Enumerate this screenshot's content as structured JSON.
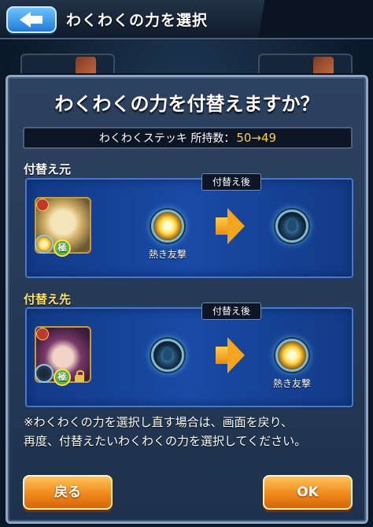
{
  "header": {
    "title": "わくわくの力を選択"
  },
  "dialog": {
    "title": "わくわくの力を付替えますか？",
    "item_name": "わくわくステッキ 所持数：",
    "item_count": "50→49",
    "source": {
      "label": "付替え元",
      "after_tag": "付替え後",
      "before_orb_caption": "熱き友撃",
      "after_orb_caption": ""
    },
    "target": {
      "label": "付替え先",
      "after_tag": "付替え後",
      "before_orb_caption": "",
      "after_orb_caption": "熱き友撃"
    },
    "notice_line1": "※わくわくの力を選択し直す場合は、画面を戻り、",
    "notice_line2": "再度、付替えたいわくわくの力を選択してください。",
    "buttons": {
      "back_label": "戻る",
      "ok_label": "OK"
    },
    "rank_badge": "極"
  },
  "colors": {
    "highlight": "#ffd23a",
    "panel": "#1a4aa6",
    "button": "#f08a1c"
  }
}
